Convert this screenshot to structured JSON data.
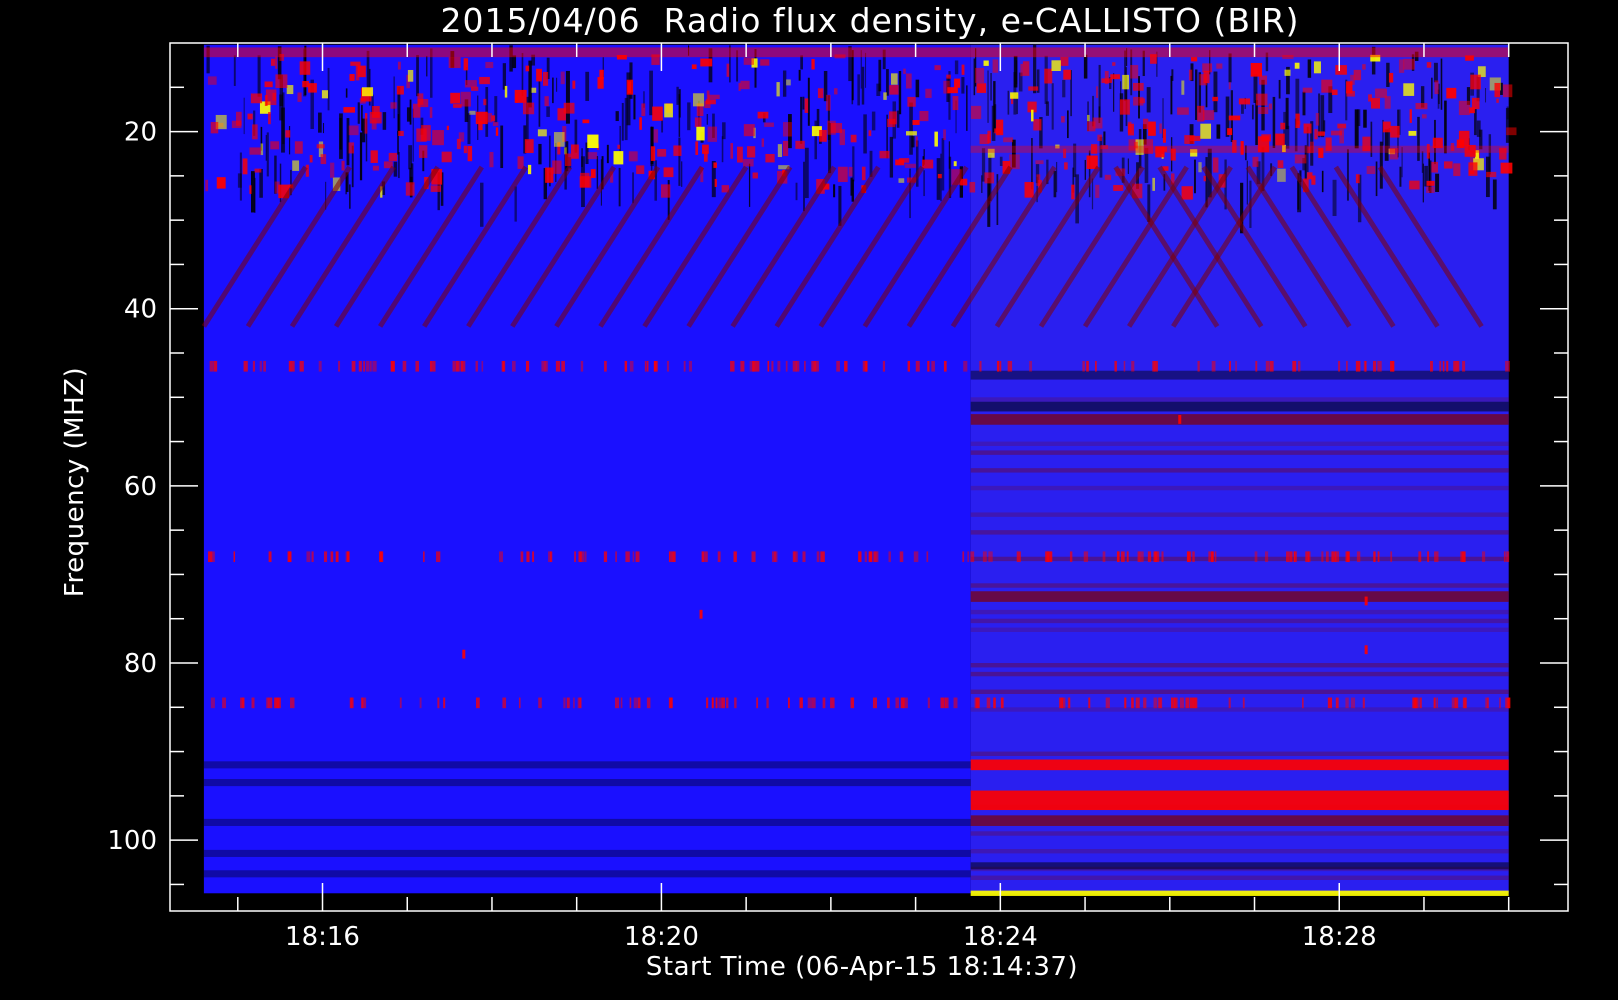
{
  "chart_data": {
    "type": "heatmap",
    "title": "2015/04/06  Radio flux density, e-CALLISTO (BIR)",
    "xlabel": "Start Time (06-Apr-15 18:14:37)",
    "ylabel": "Frequency (MHZ)",
    "x_tick_labels": [
      "18:16",
      "18:20",
      "18:24",
      "18:28"
    ],
    "x_tick_values_minutes": [
      16,
      20,
      24,
      28
    ],
    "x_range_minutes": [
      14.2,
      30.7
    ],
    "data_time_range_minutes": [
      14.6,
      30.0
    ],
    "y_tick_labels": [
      "20",
      "40",
      "60",
      "80",
      "100"
    ],
    "y_tick_values": [
      20,
      40,
      60,
      80,
      100
    ],
    "ylim": [
      10,
      108
    ],
    "y_inverted": true,
    "data_freq_range": [
      10.2,
      106
    ],
    "colormap": [
      "#000000",
      "#0000ff",
      "#800000",
      "#ff0000",
      "#ffff00"
    ],
    "background_color": "#000000",
    "axis_color": "#ffffff",
    "features": {
      "receiver_switch_time_minutes": 23.65,
      "persistent_bands_mhz_after_switch": [
        52.5,
        72.5,
        91.5,
        95.5,
        97.8,
        106
      ],
      "intermittent_bands_mhz": [
        46.5,
        68,
        84.5
      ],
      "interference_region_mhz": [
        10.2,
        30
      ]
    }
  }
}
